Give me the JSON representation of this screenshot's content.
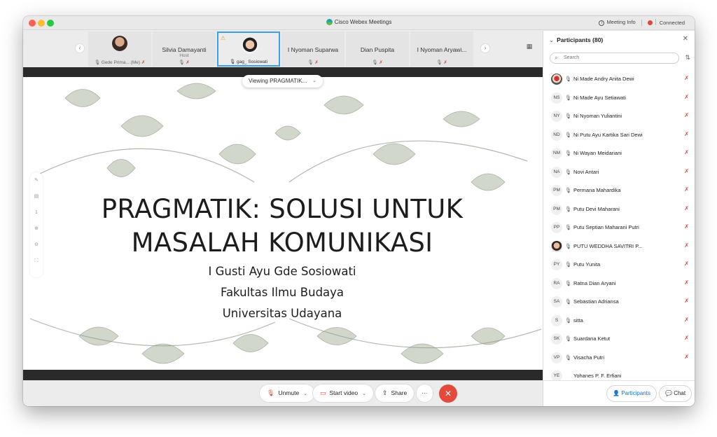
{
  "window": {
    "title": "Cisco Webex Meetings",
    "meeting_info_label": "Meeting Info",
    "connection_status": "Connected"
  },
  "strip": {
    "participants": [
      {
        "name": "Gede Prima...",
        "suffix": "(Me)",
        "has_photo": true
      },
      {
        "name": "Silvia Damayanti",
        "role": "Host"
      },
      {
        "name": "gag_ Sosiowati",
        "has_photo": true,
        "active": true
      },
      {
        "name": "I Nyoman Suparwa"
      },
      {
        "name": "Dian Puspita"
      },
      {
        "name": "I Nyoman Aryawi..."
      }
    ]
  },
  "stage": {
    "viewing_label": "Viewing PRAGMATIK...",
    "page_number": "1",
    "slide": {
      "title_line1": "PRAGMATIK: SOLUSI UNTUK",
      "title_line2": "MASALAH KOMUNIKASI",
      "author": "I Gusti Ayu Gde Sosiowati",
      "faculty": "Fakultas Ilmu Budaya",
      "university": "Universitas Udayana"
    }
  },
  "controls": {
    "unmute_label": "Unmute",
    "start_video_label": "Start video",
    "share_label": "Share",
    "more_label": "···"
  },
  "panel": {
    "title": "Participants (80)",
    "search_placeholder": "Search",
    "participants": [
      {
        "initials": "",
        "photo": "photo2",
        "name": "Ni Made Andry Anita Dewi",
        "mic": true
      },
      {
        "initials": "NS",
        "name": "Ni Made Ayu Setiawati",
        "mic": true
      },
      {
        "initials": "NY",
        "name": "Ni Nyoman Yuliantini",
        "mic": true
      },
      {
        "initials": "ND",
        "name": "Ni Putu Ayu Kartika Sari Dewi",
        "mic": true
      },
      {
        "initials": "NM",
        "name": "Ni Wayan Meidariani",
        "mic": true
      },
      {
        "initials": "NA",
        "name": "Novi Antari",
        "mic": true
      },
      {
        "initials": "PM",
        "name": "Permana Mahardika",
        "mic": true
      },
      {
        "initials": "PM",
        "name": "Putu Devi Maharani",
        "mic": true
      },
      {
        "initials": "PP",
        "name": "Putu Septian Maharani Putri",
        "mic": true
      },
      {
        "initials": "",
        "photo": "photo",
        "name": "PUTU WEDDHA SAVITRI P...",
        "mic": true
      },
      {
        "initials": "PY",
        "name": "Putu Yunita",
        "mic": true
      },
      {
        "initials": "RA",
        "name": "Ratna Dian Aryani",
        "mic": true
      },
      {
        "initials": "SA",
        "name": "Sebastian Adriansa",
        "mic": true
      },
      {
        "initials": "S",
        "name": "sitta",
        "mic": true
      },
      {
        "initials": "SK",
        "name": "Suardana Ketut",
        "mic": true
      },
      {
        "initials": "VP",
        "name": "Visacha Putri",
        "mic": true
      },
      {
        "initials": "YE",
        "name": "Yohanes P. F. Erfiani",
        "mic": false
      }
    ],
    "footer_participants_label": "Participants",
    "footer_chat_label": "Chat"
  },
  "colors": {
    "accent": "#1a6fc2",
    "end_call": "#e44a3c",
    "muted_mic": "#d9443a",
    "active_tile_border": "#3aa1e8"
  }
}
